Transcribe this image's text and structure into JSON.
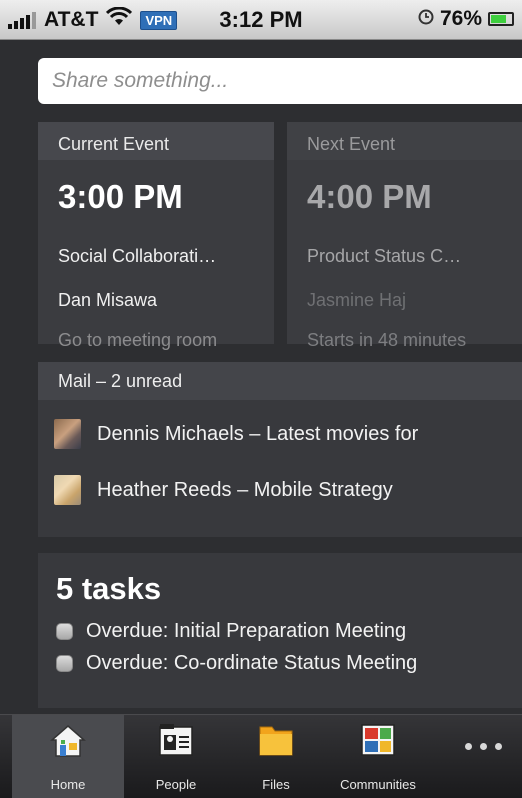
{
  "status_bar": {
    "carrier": "AT&T",
    "vpn": "VPN",
    "time": "3:12 PM",
    "battery": "76%",
    "battery_level": 0.76
  },
  "share": {
    "placeholder": "Share something..."
  },
  "events": {
    "current": {
      "header": "Current Event",
      "time": "3:00 PM",
      "title": "Social Collaborati…",
      "person": "Dan Misawa",
      "action": "Go to meeting room"
    },
    "next": {
      "header": "Next Event",
      "time": "4:00 PM",
      "title": "Product Status C…",
      "person": "Jasmine Haj",
      "action": "Starts in 48 minutes"
    }
  },
  "mail": {
    "header": "Mail – 2 unread",
    "items": [
      {
        "text": "Dennis Michaels – Latest movies for"
      },
      {
        "text": "Heather Reeds – Mobile Strategy"
      }
    ]
  },
  "tasks": {
    "count": "5 tasks",
    "items": [
      {
        "text": "Overdue: Initial Preparation Meeting"
      },
      {
        "text": "Overdue: Co-ordinate Status Meeting"
      }
    ]
  },
  "tabs": [
    {
      "label": "Home",
      "icon": "home-icon"
    },
    {
      "label": "People",
      "icon": "people-icon"
    },
    {
      "label": "Files",
      "icon": "folder-icon"
    },
    {
      "label": "Communities",
      "icon": "communities-icon"
    },
    {
      "label": "",
      "icon": "more-icon"
    }
  ],
  "colors": {
    "background": "#2d2e31",
    "card": "#3b3c40",
    "battery": "#3ecf3e",
    "vpn_badge": "#2f6fb7"
  }
}
